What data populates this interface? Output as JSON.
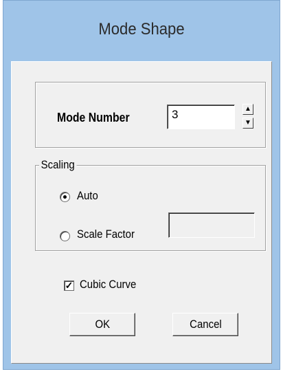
{
  "window": {
    "title": "Mode Shape"
  },
  "mode": {
    "label": "Mode Number",
    "value": "3",
    "spin_up_icon": "arrow-up-icon",
    "spin_down_icon": "arrow-down-icon"
  },
  "scaling": {
    "group_label": "Scaling",
    "options": [
      {
        "label": "Auto",
        "selected": true
      },
      {
        "label": "Scale Factor",
        "selected": false
      }
    ],
    "scale_factor_value": ""
  },
  "cubic_curve": {
    "label": "Cubic Curve",
    "checked": true
  },
  "buttons": {
    "ok": "OK",
    "cancel": "Cancel"
  }
}
